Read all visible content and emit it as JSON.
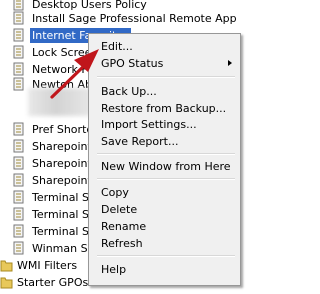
{
  "tree": {
    "items": [
      {
        "label": "Desktop Users Policy"
      },
      {
        "label": "Install Sage Professional Remote App"
      },
      {
        "label": "Internet Favorites"
      },
      {
        "label": "Lock Scree"
      },
      {
        "label": "Network F"
      },
      {
        "label": "Newton Ab"
      },
      {
        "label": "Pref Shortc"
      },
      {
        "label": "Sharepoint"
      },
      {
        "label": "Sharepoint"
      },
      {
        "label": "Sharepoint"
      },
      {
        "label": "Terminal Se"
      },
      {
        "label": "Terminal Se"
      },
      {
        "label": "Terminal Se"
      },
      {
        "label": "Winman Sh"
      },
      {
        "label": "WMI Filters"
      },
      {
        "label": "Starter GPOs"
      }
    ]
  },
  "context_menu": {
    "items": [
      {
        "label": "Edit..."
      },
      {
        "label": "GPO Status"
      },
      {
        "label": "Back Up..."
      },
      {
        "label": "Restore from Backup..."
      },
      {
        "label": "Import Settings..."
      },
      {
        "label": "Save Report..."
      },
      {
        "label": "New Window from Here"
      },
      {
        "label": "Copy"
      },
      {
        "label": "Delete"
      },
      {
        "label": "Rename"
      },
      {
        "label": "Refresh"
      },
      {
        "label": "Help"
      }
    ]
  },
  "colors": {
    "selection": "#3169c6",
    "menu_background": "#f0f0f0",
    "annotation_arrow": "#c0161b"
  },
  "icons": {
    "gpo_link": "scroll-icon",
    "wmi_filters": "folder-icon",
    "starter_gpos": "folder-icon"
  }
}
